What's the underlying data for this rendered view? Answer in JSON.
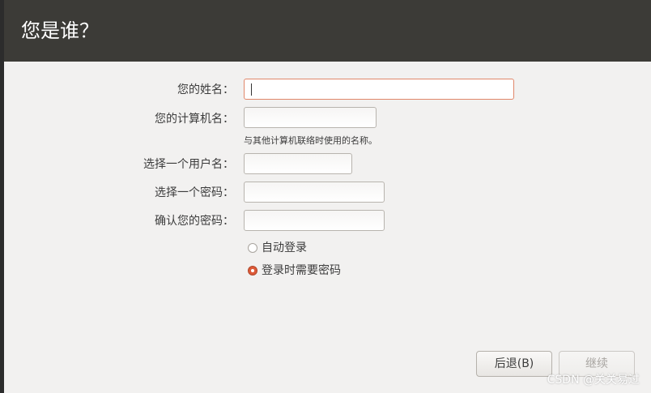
{
  "header": {
    "title": "您是谁？"
  },
  "form": {
    "name_label": "您的姓名：",
    "name_value": "",
    "computer_label": "您的计算机名：",
    "computer_value": "",
    "computer_hint": "与其他计算机联络时使用的名称。",
    "username_label": "选择一个用户名：",
    "username_value": "",
    "password_label": "选择一个密码：",
    "password_value": "",
    "confirm_label": "确认您的密码：",
    "confirm_value": ""
  },
  "login_options": {
    "auto_login": {
      "label": "自动登录",
      "selected": false
    },
    "require_password": {
      "label": "登录时需要密码",
      "selected": true
    }
  },
  "buttons": {
    "back": "后退(B)",
    "continue": "继续"
  },
  "watermark": "CSDN @关关易过",
  "colors": {
    "header_bg": "#3c3b37",
    "accent": "#dd5a38",
    "focus_border": "#e0876a",
    "page_bg": "#f2f1f0"
  }
}
